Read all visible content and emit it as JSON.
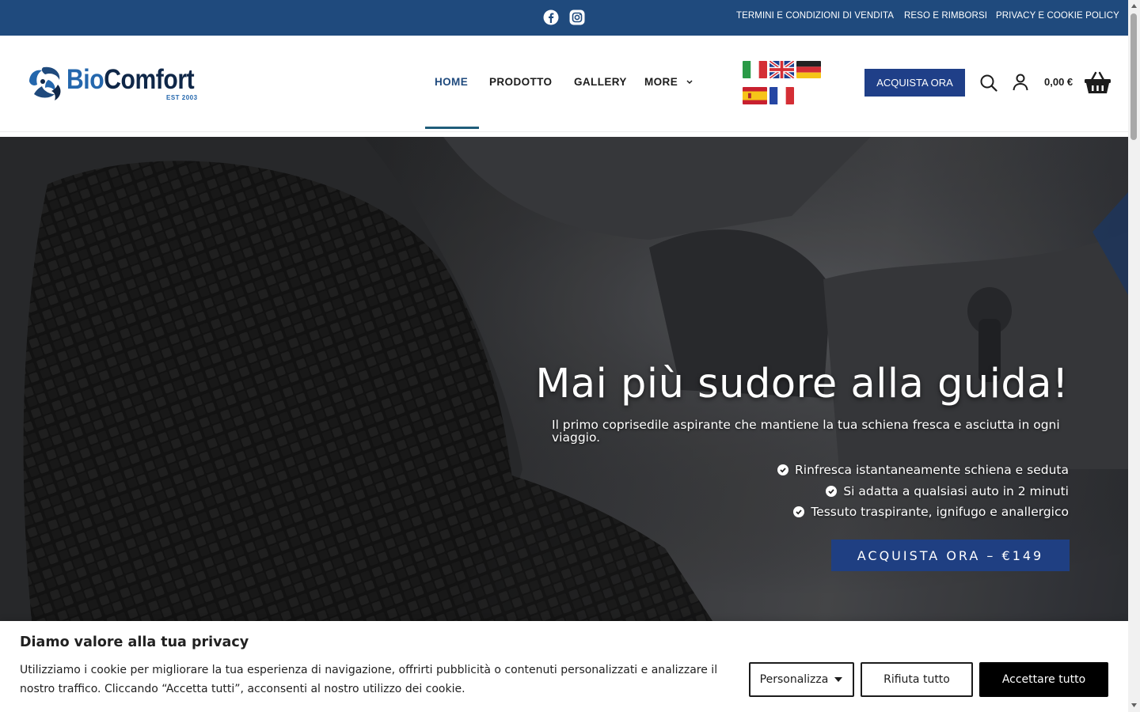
{
  "topbar": {
    "social": [
      {
        "name": "facebook-icon"
      },
      {
        "name": "instagram-icon"
      }
    ],
    "links": [
      "TERMINI E CONDIZIONI DI VENDITA",
      "RESO E RIMBORSI",
      "PRIVACY E COOKIE POLICY"
    ]
  },
  "header": {
    "logo": {
      "bio": "Bio",
      "comfort": "Comfort",
      "est": "EST 2003"
    },
    "nav": [
      "HOME",
      "PRODOTTO",
      "GALLERY",
      "MORE"
    ],
    "active_nav": "HOME",
    "flags": [
      "italian",
      "english",
      "german",
      "spanish",
      "french"
    ],
    "buy_button": "ACQUISTA ORA",
    "cart_total": "0,00 €",
    "icons": [
      "search-icon",
      "user-icon",
      "basket-icon"
    ]
  },
  "hero": {
    "title": "Mai più sudore alla guida!",
    "subtitle": "Il primo coprisedile aspirante che mantiene la tua schiena fresca e asciutta in ogni viaggio.",
    "bullets": [
      "Rinfresca istantaneamente schiena e seduta",
      "Si adatta a qualsiasi auto in 2 minuti",
      "Tessuto traspirante, ignifugo e anallergico"
    ],
    "cta": "ACQUISTA ORA – €149"
  },
  "cookie": {
    "title": "Diamo valore alla tua privacy",
    "text": "Utilizziamo i cookie per migliorare la tua esperienza di navigazione, offrirti pubblicità o contenuti personalizzati e analizzare il nostro traffico. Cliccando “Accetta tutti”, acconsenti al nostro utilizzo dei cookie.",
    "customize": "Personalizza",
    "reject": "Rifiuta tutto",
    "accept": "Accettare tutto"
  },
  "colors": {
    "brand_blue": "#1f4a7d",
    "button_blue": "#1f3f88"
  }
}
